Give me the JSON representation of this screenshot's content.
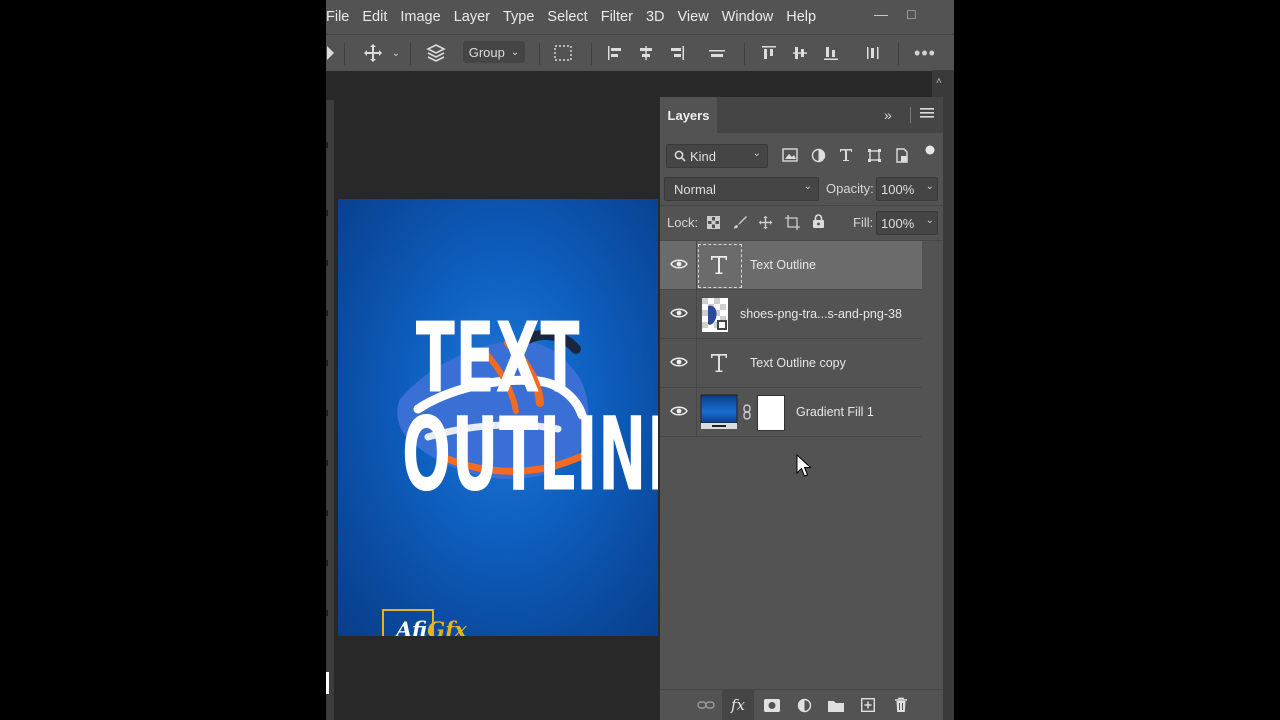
{
  "menu": [
    "File",
    "Edit",
    "Image",
    "Layer",
    "Type",
    "Select",
    "Filter",
    "3D",
    "View",
    "Window",
    "Help"
  ],
  "options_bar": {
    "auto_select_target": "Group"
  },
  "canvas_art": {
    "line1": "TEXT",
    "line2": "OUTLINE",
    "logo_part1": "Afi",
    "logo_part2": "Gfx"
  },
  "layers_panel": {
    "tab": "Layers",
    "filter_kind": "Kind",
    "blend_mode": "Normal",
    "opacity_label": "Opacity:",
    "opacity_value": "100%",
    "lock_label": "Lock:",
    "fill_label": "Fill:",
    "fill_value": "100%",
    "layers": [
      {
        "name": "Text Outline",
        "type": "text",
        "selected": true
      },
      {
        "name": "shoes-png-tra...s-and-png-38",
        "type": "smart-object",
        "selected": false
      },
      {
        "name": "Text Outline copy",
        "type": "text",
        "selected": false
      },
      {
        "name": "Gradient Fill 1",
        "type": "fill",
        "selected": false
      }
    ]
  },
  "colors": {
    "panel": "#535353",
    "workspace": "#282828",
    "selected_layer": "#6b6b6b",
    "canvas_blue": "#0e5fbf",
    "logo_gold": "#e7b31a"
  }
}
